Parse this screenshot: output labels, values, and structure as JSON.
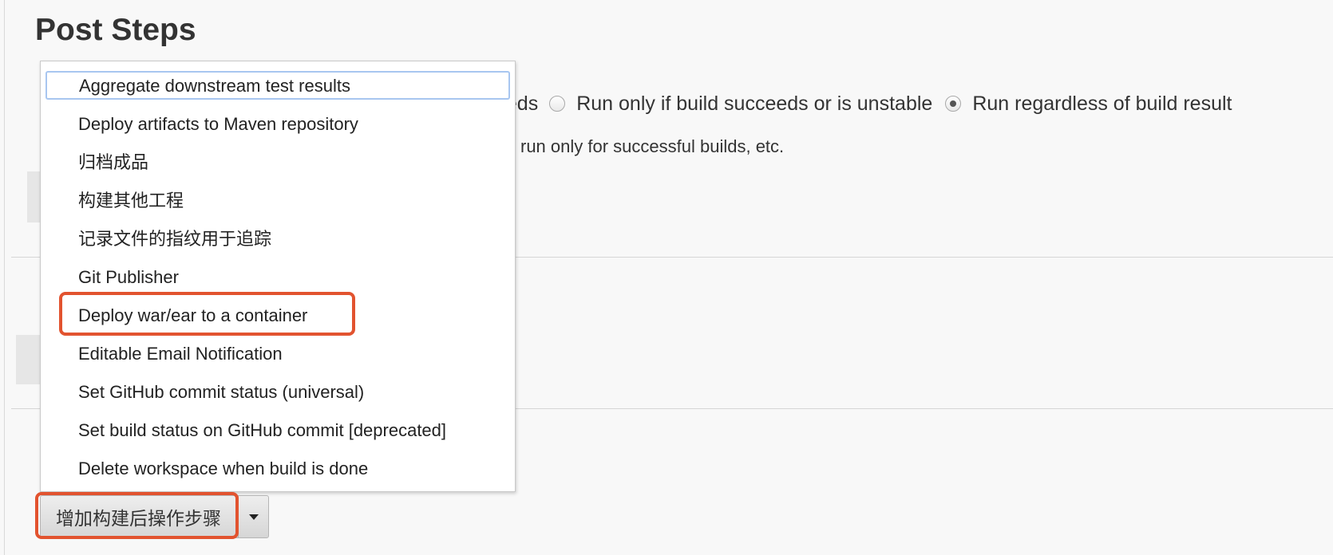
{
  "section": {
    "title": "Post Steps"
  },
  "radio_group": {
    "partial_label": "eeds",
    "options": [
      {
        "label": "Run only if build succeeds or is unstable",
        "selected": false
      },
      {
        "label": "Run regardless of build result",
        "selected": true
      }
    ]
  },
  "help": {
    "partial_text": "run only for successful builds, etc."
  },
  "dropdown_menu": {
    "focused_index": 0,
    "highlighted_index": 6,
    "items": [
      {
        "label": "Aggregate downstream test results"
      },
      {
        "label": "Deploy artifacts to Maven repository"
      },
      {
        "label": "归档成品"
      },
      {
        "label": "构建其他工程"
      },
      {
        "label": "记录文件的指纹用于追踪"
      },
      {
        "label": "Git Publisher"
      },
      {
        "label": "Deploy war/ear to a container"
      },
      {
        "label": "Editable Email Notification"
      },
      {
        "label": "Set GitHub commit status (universal)"
      },
      {
        "label": "Set build status on GitHub commit [deprecated]"
      },
      {
        "label": "Delete workspace when build is done"
      }
    ]
  },
  "add_button": {
    "label": "增加构建后操作步骤",
    "dropdown_icon": "caret-down-icon"
  },
  "colors": {
    "callout": "#e2532f",
    "focus_ring": "#a8c6f0",
    "page_background": "#f8f8f8"
  }
}
